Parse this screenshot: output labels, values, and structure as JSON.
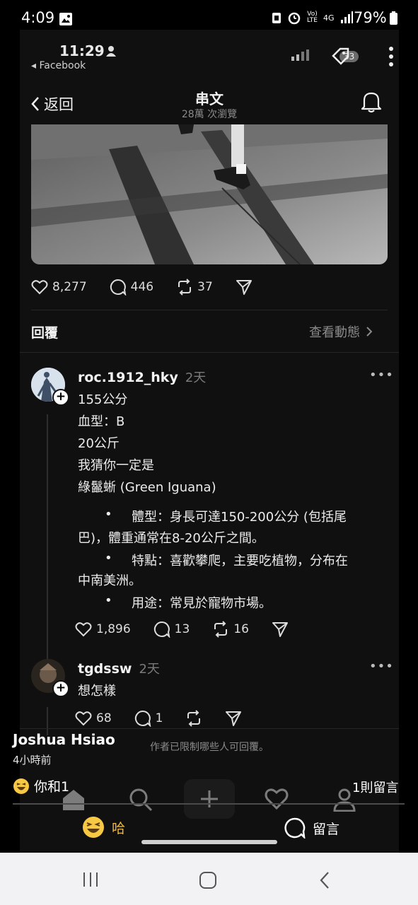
{
  "status_bar": {
    "time": "4:09",
    "network_label_top": "Vo)",
    "network_label_bottom": "LTE",
    "network_gen": "4G",
    "battery": "79%"
  },
  "inner_status": {
    "time": "11:29",
    "back_to": "◂ Facebook",
    "badge": "33"
  },
  "header": {
    "back_label": "返回",
    "title": "串文",
    "subtitle": "28萬 次瀏覽"
  },
  "post": {
    "likes": "8,277",
    "replies": "446",
    "reposts": "37"
  },
  "replies_section": {
    "label": "回覆",
    "view_activity": "查看動態"
  },
  "replies": [
    {
      "username": "roc.1912_hky",
      "time": "2天",
      "lines": [
        "155公分",
        "血型：B",
        "20公斤",
        "我猜你一定是",
        "綠鬣蜥 (Green Iguana)"
      ],
      "bullets": [
        {
          "marker": "•",
          "first": "體型：身長可達150-200公分 (包括尾",
          "second": "巴)，體重通常在8-20公斤之間。"
        },
        {
          "marker": "•",
          "first": "特點：喜歡攀爬，主要吃植物，分布在",
          "second": "中南美洲。"
        },
        {
          "marker": "•",
          "first": "用途：常見於寵物市場。",
          "second": ""
        }
      ],
      "likes": "1,896",
      "replies": "13",
      "reposts": "16"
    },
    {
      "username": "tgdssw",
      "time": "2天",
      "lines": [
        "想怎樣"
      ],
      "likes": "68",
      "replies": "1"
    }
  ],
  "restriction_note": "作者已限制哪些人可回覆。",
  "facebook": {
    "name": "Joshua Hsiao",
    "time": "4小時前",
    "reactions": "你和1",
    "comment_count": "1則留言",
    "haha_label": "哈",
    "comment_label": "留言"
  },
  "colors": {
    "background": "#101010",
    "haha_accent": "#f0b93c",
    "android_nav": "#f2f2f4"
  }
}
